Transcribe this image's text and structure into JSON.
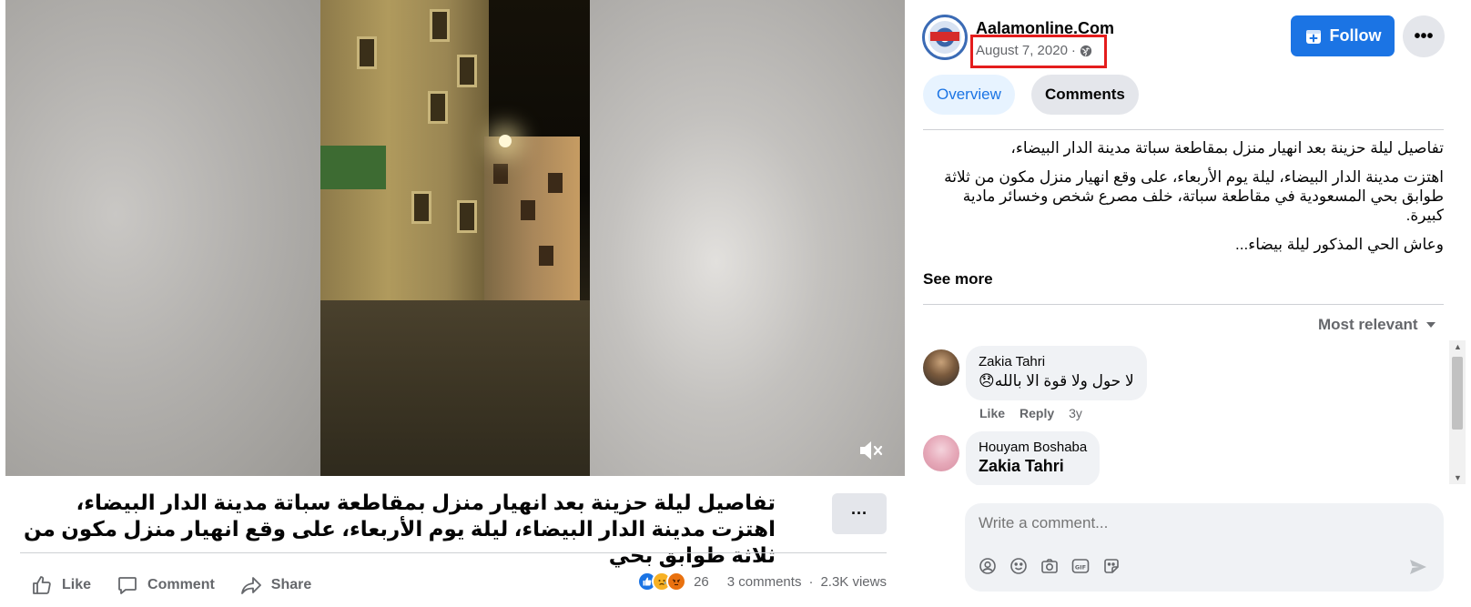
{
  "video": {
    "mute_icon": "speaker-muted-icon"
  },
  "post": {
    "caption": "تفاصيل ليلة حزينة بعد انهيار منزل بمقاطعة سباتة مدينة الدار البيضاء، اهتزت مدينة الدار البيضاء، ليلة يوم الأربعاء، على وقع انهيار منزل مكون من ثلاثة طوابق بحي",
    "more_label": "···"
  },
  "actions": {
    "like": "Like",
    "comment": "Comment",
    "share": "Share"
  },
  "stats": {
    "reaction_count": "26",
    "comments": "3 comments",
    "separator": "·",
    "views": "2.3K views"
  },
  "page": {
    "name": "Aalamonline.Com",
    "date": "August 7, 2020",
    "audience_separator": "·",
    "follow_label": "Follow",
    "more_label": "•••"
  },
  "tabs": {
    "overview": "Overview",
    "comments": "Comments"
  },
  "description": {
    "p1": "تفاصيل ليلة حزينة بعد انهيار منزل بمقاطعة سباتة مدينة الدار البيضاء،",
    "p2": "اهتزت مدينة الدار البيضاء، ليلة يوم الأربعاء، على وقع انهيار منزل مكون من ثلاثة طوابق بحي المسعودية في مقاطعة سباتة، خلف مصرع شخص وخسائر مادية كبيرة.",
    "p3": "وعاش الحي المذكور ليلة بيضاء...",
    "see_more": "See more"
  },
  "sort": {
    "label": "Most relevant"
  },
  "comments": [
    {
      "author": "Zakia Tahri",
      "text": "لا حول ولا قوة الا بالله😞",
      "like": "Like",
      "reply": "Reply",
      "time": "3y"
    },
    {
      "author": "Houyam Boshaba",
      "text": "Zakia Tahri"
    }
  ],
  "composer": {
    "placeholder": "Write a comment..."
  },
  "colors": {
    "accent": "#1b74e4",
    "highlight_box": "#e41d1d"
  }
}
